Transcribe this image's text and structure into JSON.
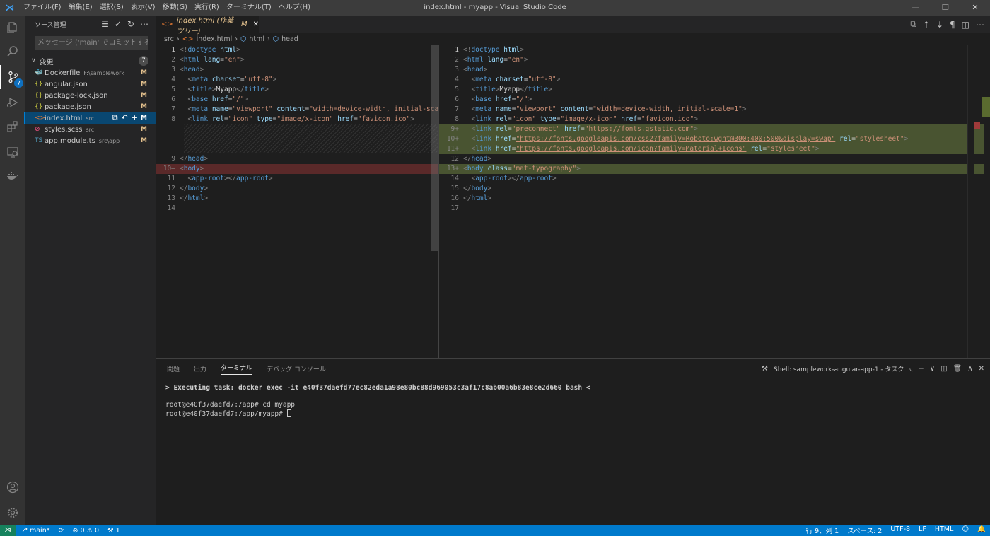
{
  "window": {
    "title": "index.html - myapp - Visual Studio Code",
    "menu": [
      "ファイル(F)",
      "編集(E)",
      "選択(S)",
      "表示(V)",
      "移動(G)",
      "実行(R)",
      "ターミナル(T)",
      "ヘルプ(H)"
    ],
    "controls": [
      "—",
      "❐",
      "✕"
    ]
  },
  "activity": {
    "scm_badge": "7"
  },
  "sidebar": {
    "title": "ソース管理",
    "commit_placeholder": "メッセージ ('main' でコミットする...",
    "changes_label": "変更",
    "changes_count": "7",
    "files": [
      {
        "name": "Dockerfile",
        "path": "F:\\samplework",
        "status": "M",
        "icon": "🐳",
        "icon_color": "#3a94ee"
      },
      {
        "name": "angular.json",
        "path": "",
        "status": "M",
        "icon": "{}",
        "icon_color": "#cbcb41"
      },
      {
        "name": "package-lock.json",
        "path": "",
        "status": "M",
        "icon": "{}",
        "icon_color": "#cbcb41"
      },
      {
        "name": "package.json",
        "path": "",
        "status": "M",
        "icon": "{}",
        "icon_color": "#cbcb41"
      },
      {
        "name": "index.html",
        "path": "src",
        "status": "M",
        "icon": "<>",
        "icon_color": "#e37933"
      },
      {
        "name": "styles.scss",
        "path": "src",
        "status": "M",
        "icon": "⊘",
        "icon_color": "#f55385"
      },
      {
        "name": "app.module.ts",
        "path": "src\\app",
        "status": "M",
        "icon": "TS",
        "icon_color": "#519aba"
      }
    ]
  },
  "editor": {
    "tab_label": "index.html (作業ツリー)",
    "tab_status": "M",
    "breadcrumb": [
      "src",
      "index.html",
      "html",
      "head"
    ],
    "left_lines": [
      {
        "n": "1",
        "html": "<span class='p'>&lt;!</span><span class='t'>doctype</span> <span class='a'>html</span><span class='p'>&gt;</span>"
      },
      {
        "n": "2",
        "html": "<span class='p'>&lt;</span><span class='t'>html</span> <span class='a'>lang</span><span class='w'>=</span><span class='s'>\"en\"</span><span class='p'>&gt;</span>"
      },
      {
        "n": "3",
        "html": "<span class='p'>&lt;</span><span class='t'>head</span><span class='p'>&gt;</span>"
      },
      {
        "n": "4",
        "html": "  <span class='p'>&lt;</span><span class='t'>meta</span> <span class='a'>charset</span><span class='w'>=</span><span class='s'>\"utf-8\"</span><span class='p'>&gt;</span>"
      },
      {
        "n": "5",
        "html": "  <span class='p'>&lt;</span><span class='t'>title</span><span class='p'>&gt;</span><span class='w'>Myapp</span><span class='p'>&lt;/</span><span class='t'>title</span><span class='p'>&gt;</span>"
      },
      {
        "n": "6",
        "html": "  <span class='p'>&lt;</span><span class='t'>base</span> <span class='a'>href</span><span class='w'>=</span><span class='s'>\"/\"</span><span class='p'>&gt;</span>"
      },
      {
        "n": "7",
        "html": "  <span class='p'>&lt;</span><span class='t'>meta</span> <span class='a'>name</span><span class='w'>=</span><span class='s'>\"viewport\"</span> <span class='a'>content</span><span class='w'>=</span><span class='s'>\"width=device-width, initial-sca</span>"
      },
      {
        "n": "8",
        "html": "  <span class='p'>&lt;</span><span class='t'>link</span> <span class='a'>rel</span><span class='w'>=</span><span class='s'>\"icon\"</span> <span class='a'>type</span><span class='w'>=</span><span class='s'>\"image/x-icon\"</span> <span class='a'>href</span><span class='w'>=</span><span class='s u'>\"favicon.ico\"</span><span class='p'>&gt;</span>"
      },
      {
        "n": "9",
        "html": "<span class='p'>&lt;/</span><span class='t'>head</span><span class='p'>&gt;</span>"
      },
      {
        "n": "10—",
        "html": "<span class='p'>&lt;</span><span class='t'>body</span><span class='p'>&gt;</span>"
      },
      {
        "n": "11",
        "html": "  <span class='p'>&lt;</span><span class='t'>app-root</span><span class='p'>&gt;&lt;/</span><span class='t'>app-root</span><span class='p'>&gt;</span>"
      },
      {
        "n": "12",
        "html": "<span class='p'>&lt;/</span><span class='t'>body</span><span class='p'>&gt;</span>"
      },
      {
        "n": "13",
        "html": "<span class='p'>&lt;/</span><span class='t'>html</span><span class='p'>&gt;</span>"
      },
      {
        "n": "14",
        "html": ""
      }
    ],
    "right_lines": [
      {
        "n": "1",
        "html": "<span class='p'>&lt;!</span><span class='t'>doctype</span> <span class='a'>html</span><span class='p'>&gt;</span>"
      },
      {
        "n": "2",
        "html": "<span class='p'>&lt;</span><span class='t'>html</span> <span class='a'>lang</span><span class='w'>=</span><span class='s'>\"en\"</span><span class='p'>&gt;</span>"
      },
      {
        "n": "3",
        "html": "<span class='p'>&lt;</span><span class='t'>head</span><span class='p'>&gt;</span>"
      },
      {
        "n": "4",
        "html": "  <span class='p'>&lt;</span><span class='t'>meta</span> <span class='a'>charset</span><span class='w'>=</span><span class='s'>\"utf-8\"</span><span class='p'>&gt;</span>"
      },
      {
        "n": "5",
        "html": "  <span class='p'>&lt;</span><span class='t'>title</span><span class='p'>&gt;</span><span class='w'>Myapp</span><span class='p'>&lt;/</span><span class='t'>title</span><span class='p'>&gt;</span>"
      },
      {
        "n": "6",
        "html": "  <span class='p'>&lt;</span><span class='t'>base</span> <span class='a'>href</span><span class='w'>=</span><span class='s'>\"/\"</span><span class='p'>&gt;</span>"
      },
      {
        "n": "7",
        "html": "  <span class='p'>&lt;</span><span class='t'>meta</span> <span class='a'>name</span><span class='w'>=</span><span class='s'>\"viewport\"</span> <span class='a'>content</span><span class='w'>=</span><span class='s'>\"width=device-width, initial-scale=1\"</span><span class='p'>&gt;</span>"
      },
      {
        "n": "8",
        "html": "  <span class='p'>&lt;</span><span class='t'>link</span> <span class='a'>rel</span><span class='w'>=</span><span class='s'>\"icon\"</span> <span class='a'>type</span><span class='w'>=</span><span class='s'>\"image/x-icon\"</span> <span class='a'>href</span><span class='w'>=</span><span class='s u'>\"favicon.ico\"</span><span class='p'>&gt;</span>"
      },
      {
        "n": "9+",
        "html": "  <span class='p'>&lt;</span><span class='t'>link</span> <span class='a'>rel</span><span class='w'>=</span><span class='s'>\"preconnect\"</span> <span class='a'>href</span><span class='w'>=</span><span class='s u'>\"https://fonts.gstatic.com\"</span><span class='p'>&gt;</span>"
      },
      {
        "n": "10+",
        "html": "  <span class='p'>&lt;</span><span class='t'>link</span> <span class='a'>href</span><span class='w'>=</span><span class='s u'>\"https://fonts.googleapis.com/css2?family=Roboto:wght@300;400;500&amp;display=swap\"</span> <span class='a'>rel</span><span class='w'>=</span><span class='s'>\"stylesheet\"</span><span class='p'>&gt;</span>"
      },
      {
        "n": "11+",
        "html": "  <span class='p'>&lt;</span><span class='t'>link</span> <span class='a'>href</span><span class='w'>=</span><span class='s u'>\"https://fonts.googleapis.com/icon?family=Material+Icons\"</span> <span class='a'>rel</span><span class='w'>=</span><span class='s'>\"stylesheet\"</span><span class='p'>&gt;</span>"
      },
      {
        "n": "12",
        "html": "<span class='p'>&lt;/</span><span class='t'>head</span><span class='p'>&gt;</span>"
      },
      {
        "n": "13+",
        "html": "<span class='p'>&lt;</span><span class='t'>body</span> <span class='a'>class</span><span class='w'>=</span><span class='s'>\"mat-typography\"</span><span class='p'>&gt;</span>"
      },
      {
        "n": "14",
        "html": "  <span class='p'>&lt;</span><span class='t'>app-root</span><span class='p'>&gt;&lt;/</span><span class='t'>app-root</span><span class='p'>&gt;</span>"
      },
      {
        "n": "15",
        "html": "<span class='p'>&lt;/</span><span class='t'>body</span><span class='p'>&gt;</span>"
      },
      {
        "n": "16",
        "html": "<span class='p'>&lt;/</span><span class='t'>html</span><span class='p'>&gt;</span>"
      },
      {
        "n": "17",
        "html": ""
      }
    ]
  },
  "panel": {
    "tabs": [
      "問題",
      "出力",
      "ターミナル",
      "デバッグ コンソール"
    ],
    "active_tab": "ターミナル",
    "shell_label": "Shell: samplework-angular-app-1 - タスク",
    "terminal": {
      "task_line": "> Executing task: docker exec -it e40f37daefd77ec82eda1a98e80bc88d969053c3af17c8ab00a6b83e8ce2d660 bash <",
      "line1": "root@e40f37daefd7:/app# cd myapp",
      "line2": "root@e40f37daefd7:/app/myapp# "
    }
  },
  "status": {
    "branch": "main*",
    "errors": "0",
    "warnings": "0",
    "ports": "1",
    "position": "行 9、列 1",
    "spaces": "スペース: 2",
    "encoding": "UTF-8",
    "eol": "LF",
    "language": "HTML"
  }
}
